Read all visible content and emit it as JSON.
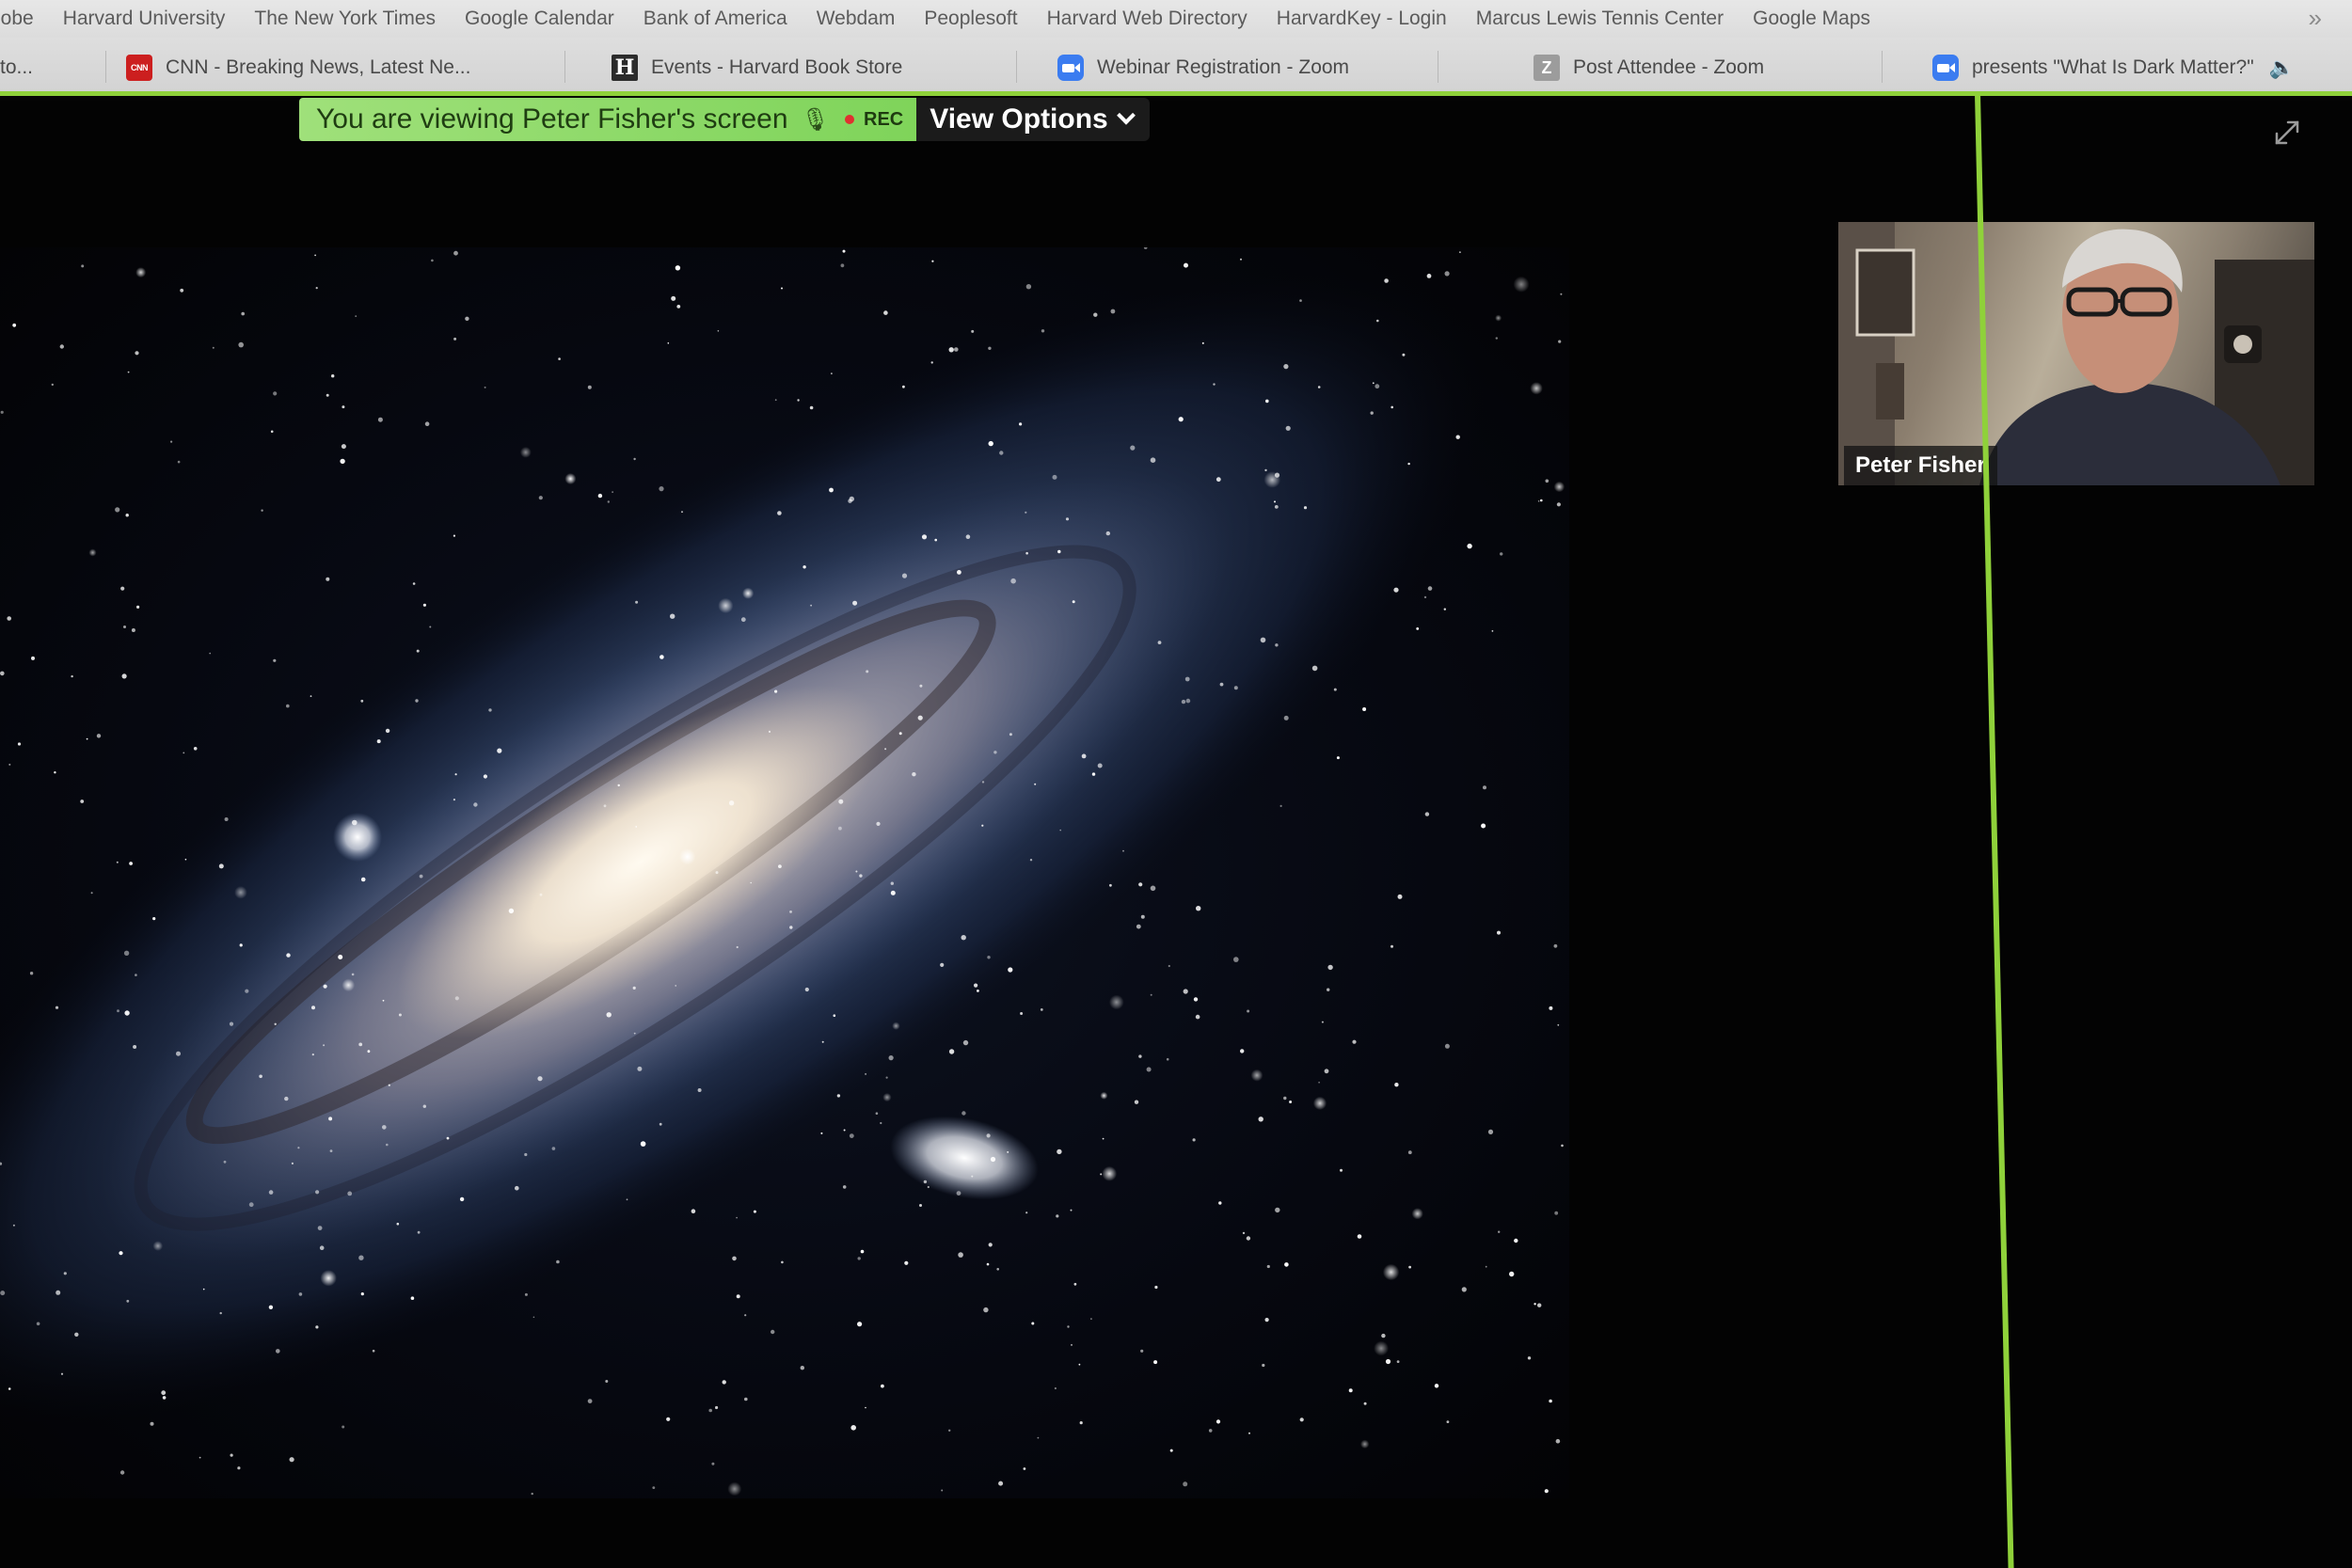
{
  "bookmarks": [
    "lobe",
    "Harvard University",
    "The New York Times",
    "Google Calendar",
    "Bank of America",
    "Webdam",
    "Peoplesoft",
    "Harvard Web Directory",
    "HarvardKey - Login",
    "Marcus Lewis Tennis Center",
    "Google Maps"
  ],
  "bookmarks_overflow": "»",
  "tabs": [
    {
      "label": "to...",
      "icon": ""
    },
    {
      "label": "CNN - Breaking News, Latest Ne...",
      "icon": "cnn-icon"
    },
    {
      "label": "Events - Harvard Book Store",
      "icon": "harvard-book-store-icon"
    },
    {
      "label": "Webinar Registration - Zoom",
      "icon": "zoom-icon"
    },
    {
      "label": "Post Attendee - Zoom",
      "icon": "zoom-z-icon"
    },
    {
      "label": "presents \"What Is Dark Matter?\"",
      "icon": "zoom-icon"
    }
  ],
  "favicon_text": {
    "cnn": "CNN",
    "h": "H",
    "z": "Z"
  },
  "zoom": {
    "banner_text": "You are viewing Peter Fisher's screen",
    "rec_label": "REC",
    "view_options_label": "View Options",
    "participant_name": "Peter Fisher"
  },
  "colors": {
    "accent_green": "#8fd13a",
    "banner_green": "#86d65e",
    "rec_red": "#e03030"
  }
}
